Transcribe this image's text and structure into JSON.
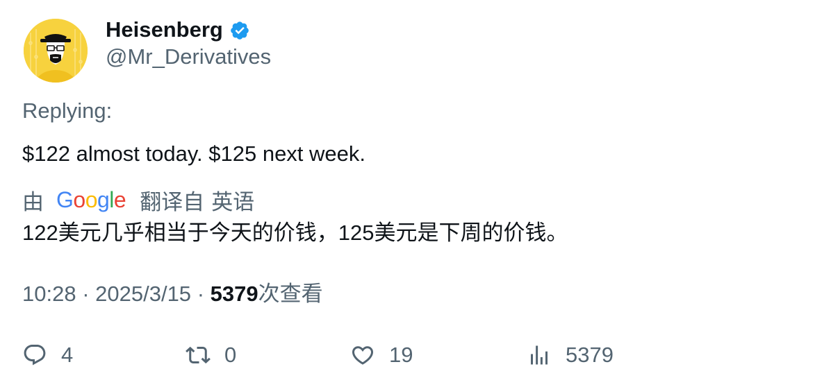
{
  "author": {
    "name": "Heisenberg",
    "handle": "@Mr_Derivatives",
    "verified_icon": "verified-badge-icon",
    "verified_color": "#1d9bf0",
    "avatar_bg": "#f7d23e"
  },
  "replying_label": "Replying:",
  "tweet_text": "$122 almost today. $125 next week.",
  "translation": {
    "by_label": "由",
    "provider": "Google",
    "from_label": "翻译自",
    "language": "英语",
    "text": "122美元几乎相当于今天的价钱，125美元是下周的价钱。"
  },
  "meta": {
    "time": "10:28",
    "separator": "·",
    "date": "2025/3/15",
    "views_count": "5379",
    "views_label": "次查看"
  },
  "actions": {
    "reply": {
      "icon": "reply-icon",
      "count": "4"
    },
    "retweet": {
      "icon": "retweet-icon",
      "count": "0"
    },
    "like": {
      "icon": "heart-icon",
      "count": "19"
    },
    "views": {
      "icon": "analytics-icon",
      "count": "5379"
    }
  },
  "colors": {
    "primary_text": "#0f1419",
    "secondary_text": "#536471"
  }
}
